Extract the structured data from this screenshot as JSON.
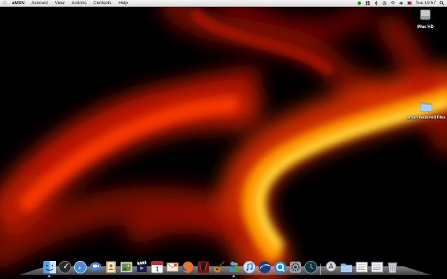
{
  "menubar": {
    "app_name": "aMSN",
    "menus": [
      "Account",
      "View",
      "Actions",
      "Contacts",
      "Help"
    ],
    "clock": "Tue 19:57"
  },
  "desktop": {
    "icons": [
      {
        "label": "iMac HD",
        "icon": "hard-drive-icon"
      },
      {
        "label": "amsn received files",
        "icon": "folder-icon"
      }
    ]
  },
  "dock": {
    "apps": [
      {
        "icon": "finder-icon",
        "running": true
      },
      {
        "icon": "dashboard-icon",
        "running": false
      },
      {
        "icon": "safari-icon",
        "running": false
      },
      {
        "icon": "ichat-icon",
        "running": false
      },
      {
        "icon": "address-book-icon",
        "running": false
      },
      {
        "icon": "preview-icon",
        "running": false
      },
      {
        "icon": "imovie-icon",
        "running": false
      },
      {
        "icon": "ical-icon",
        "running": false
      },
      {
        "icon": "mail-icon",
        "running": false
      },
      {
        "icon": "firefox-icon",
        "running": false
      },
      {
        "icon": "photo-booth-icon",
        "running": false
      },
      {
        "icon": "garageband-icon",
        "running": false
      },
      {
        "icon": "amsn-icon",
        "running": true
      },
      {
        "icon": "itunes-icon",
        "running": false
      },
      {
        "icon": "google-earth-icon",
        "running": false
      },
      {
        "icon": "quicktime-icon",
        "running": false
      },
      {
        "icon": "system-preferences-icon",
        "running": false
      },
      {
        "icon": "time-machine-icon",
        "running": false
      }
    ],
    "stacks": [
      {
        "icon": "applications-stack-icon"
      },
      {
        "icon": "folder-stack-icon"
      },
      {
        "icon": "documents-stack-icon"
      },
      {
        "icon": "downloads-stack-icon"
      },
      {
        "icon": "trash-icon"
      }
    ]
  }
}
